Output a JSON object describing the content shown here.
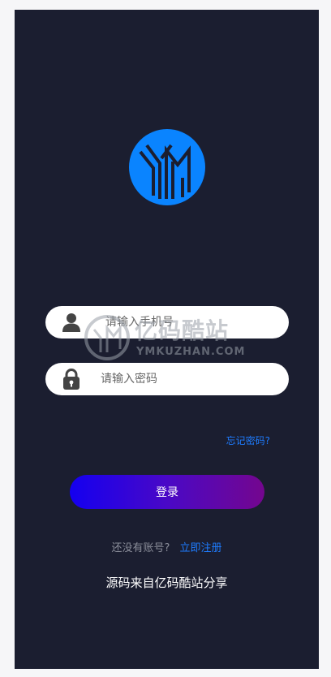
{
  "colors": {
    "background": "#1b1e30",
    "accent": "#1e7cff",
    "logo_blue": "#0a84ff",
    "button_gradient_start": "#1400f0",
    "button_gradient_end": "#74068e"
  },
  "logo": {
    "icon": "ym-logo-icon"
  },
  "phone_field": {
    "placeholder": "请输入手机号",
    "value": "",
    "icon": "user-icon"
  },
  "password_field": {
    "placeholder": "请输入密码",
    "value": "",
    "icon": "lock-icon"
  },
  "watermark": {
    "main": "亿码酷站",
    "sub": "YMKUZHAN.COM"
  },
  "forgot_password": "忘记密码?",
  "login_button": "登录",
  "register": {
    "question": "还没有账号?",
    "link": "立即注册"
  },
  "footer_note": "源码来自亿码酷站分享"
}
